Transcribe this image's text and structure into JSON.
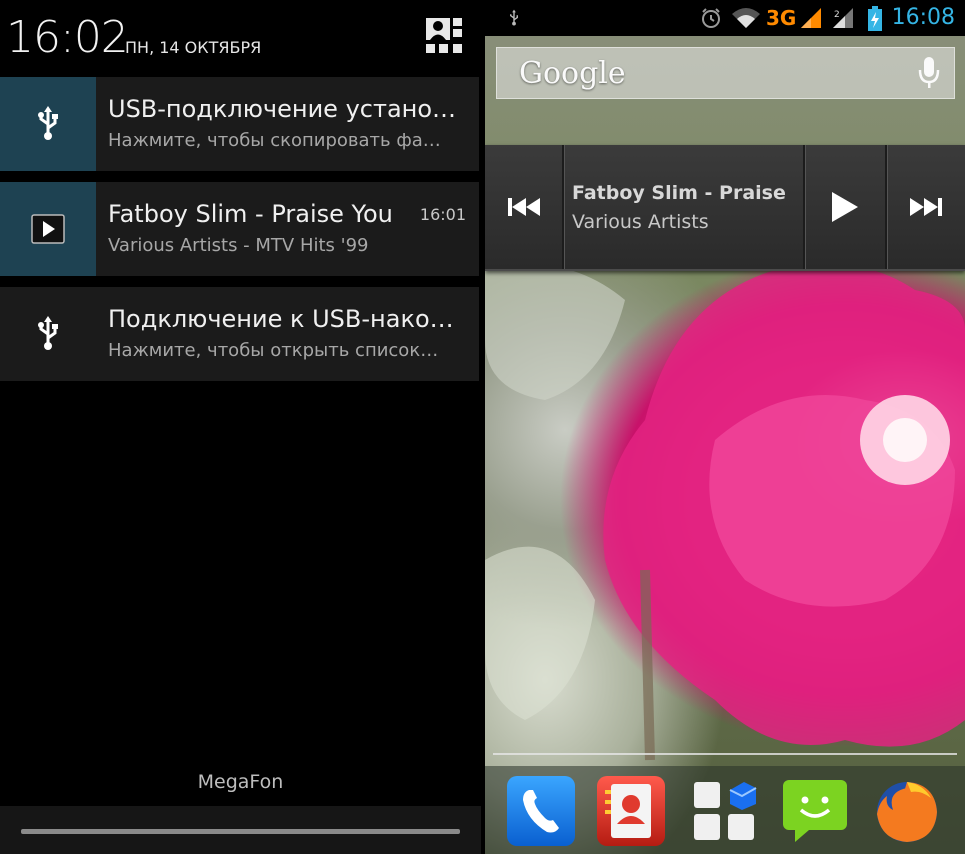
{
  "shade": {
    "time": "16:02",
    "date": "ПН, 14 ОКТЯБРЯ",
    "settings_icon": "quick-settings-icon",
    "notifications": [
      {
        "icon": "usb-icon",
        "title": "USB-подключение установ…",
        "text": "Нажмите, чтобы скопировать фа…",
        "time": ""
      },
      {
        "icon": "play-icon",
        "title": "Fatboy Slim - Praise You",
        "text": "Various Artists - MTV Hits '99",
        "time": "16:01"
      },
      {
        "icon": "usb-icon",
        "title": "Подключение к USB-накоп…",
        "text": "Нажмите, чтобы открыть список…",
        "time": ""
      }
    ],
    "carrier": "MegaFon"
  },
  "home": {
    "status": {
      "time": "16:08",
      "network": "3G"
    },
    "search": {
      "logo": "Google"
    },
    "music_widget": {
      "title": "Fatboy Slim - Praise Yo",
      "artist": "Various Artists"
    },
    "dock_apps": [
      "Phone",
      "Contacts",
      "Apps",
      "Messaging",
      "Firefox"
    ],
    "colors": {
      "accent": "#35b5e5",
      "network": "#ff8a00"
    }
  }
}
